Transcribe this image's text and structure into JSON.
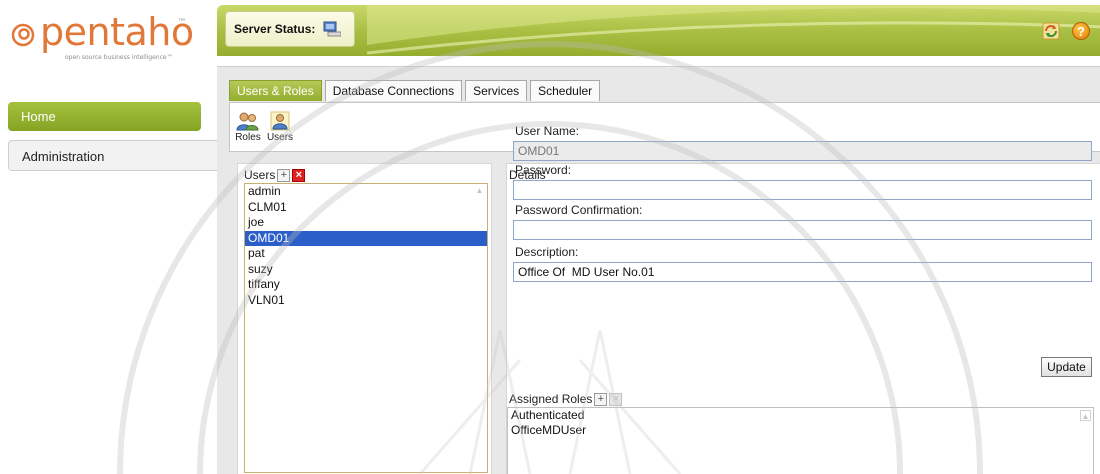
{
  "logo": {
    "word": "pentaho",
    "tm": "™",
    "tagline": "open source business intelligence™"
  },
  "header": {
    "server_status_label": "Server Status:",
    "accent": "#a9c044"
  },
  "nav": {
    "home": "Home",
    "administration": "Administration"
  },
  "tabs": [
    {
      "label": "Users & Roles",
      "active": true
    },
    {
      "label": "Database Connections",
      "active": false
    },
    {
      "label": "Services",
      "active": false
    },
    {
      "label": "Scheduler",
      "active": false
    }
  ],
  "toolbar": {
    "roles_label": "Roles",
    "users_label": "Users"
  },
  "users_panel": {
    "title": "Users",
    "users": [
      "admin",
      "CLM01",
      "joe",
      "OMD01",
      "pat",
      "suzy",
      "tiffany",
      "VLN01"
    ],
    "selected": "OMD01"
  },
  "details": {
    "title": "Details",
    "username_label": "User Name:",
    "username_value": "OMD01",
    "password_label": "Password:",
    "password_value": "",
    "confirm_label": "Password Confirmation:",
    "confirm_value": "",
    "description_label": "Description:",
    "description_value": "Office Of  MD User No.01",
    "update_label": "Update",
    "assigned_roles_label": "Assigned Roles",
    "roles": [
      "Authenticated",
      "OfficeMDUser"
    ]
  }
}
